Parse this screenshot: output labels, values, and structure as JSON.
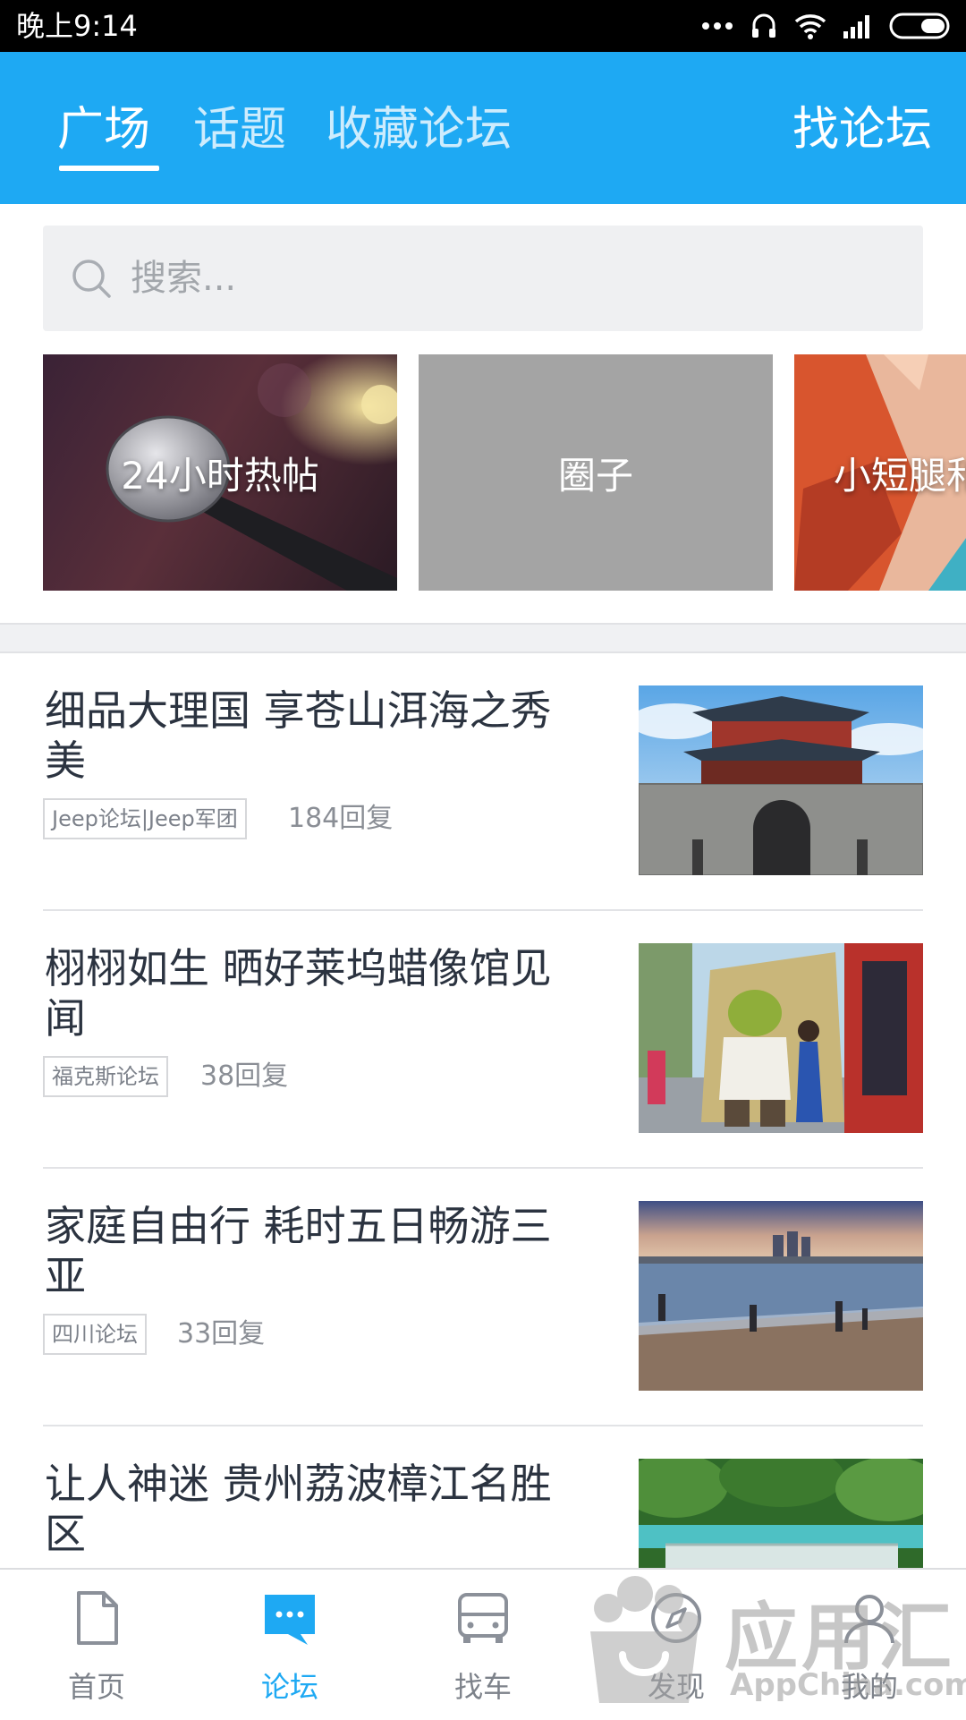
{
  "status_bar": {
    "time": "晚上9:14",
    "icons": [
      "more-dots-icon",
      "headset-icon",
      "wifi-icon",
      "signal-icon",
      "battery-icon"
    ]
  },
  "header": {
    "tabs": [
      {
        "label": "广场",
        "active": true
      },
      {
        "label": "话题",
        "active": false
      },
      {
        "label": "收藏论坛",
        "active": false
      }
    ],
    "find_forum_label": "找论坛",
    "background_color": "#1ea9f3"
  },
  "search": {
    "placeholder": "搜索..."
  },
  "categories": [
    {
      "label": "24小时热帖",
      "image": "microphone"
    },
    {
      "label": "圈子",
      "image": "gray"
    },
    {
      "label": "小短腿和",
      "image": "legs-car"
    }
  ],
  "posts": [
    {
      "title": "细品大理国 享苍山洱海之秀美",
      "forum_tag": "Jeep论坛|Jeep军团",
      "replies": "184回复",
      "thumbnail": "ancient-gate"
    },
    {
      "title": "栩栩如生 晒好莱坞蜡像馆见闻",
      "forum_tag": "福克斯论坛",
      "replies": "38回复",
      "thumbnail": "shrek-statue"
    },
    {
      "title": "家庭自由行 耗时五日畅游三亚",
      "forum_tag": "四川论坛",
      "replies": "33回复",
      "thumbnail": "sanya-beach"
    },
    {
      "title": "让人神迷 贵州荔波樟江名胜区",
      "forum_tag": "",
      "replies": "",
      "thumbnail": "waterfall-forest"
    }
  ],
  "bottom_nav": [
    {
      "label": "首页",
      "icon": "document-icon",
      "active": false
    },
    {
      "label": "论坛",
      "icon": "chat-bubble-icon",
      "active": true
    },
    {
      "label": "找车",
      "icon": "car-icon",
      "active": false
    },
    {
      "label": "发现",
      "icon": "compass-icon",
      "active": false
    },
    {
      "label": "我的",
      "icon": "person-icon",
      "active": false
    }
  ],
  "watermark": {
    "text_cn": "应用汇",
    "text_en": "AppChina.com"
  },
  "colors": {
    "accent": "#1ea9f3",
    "title_text": "#2b3340",
    "meta_text": "#8a8e95"
  }
}
